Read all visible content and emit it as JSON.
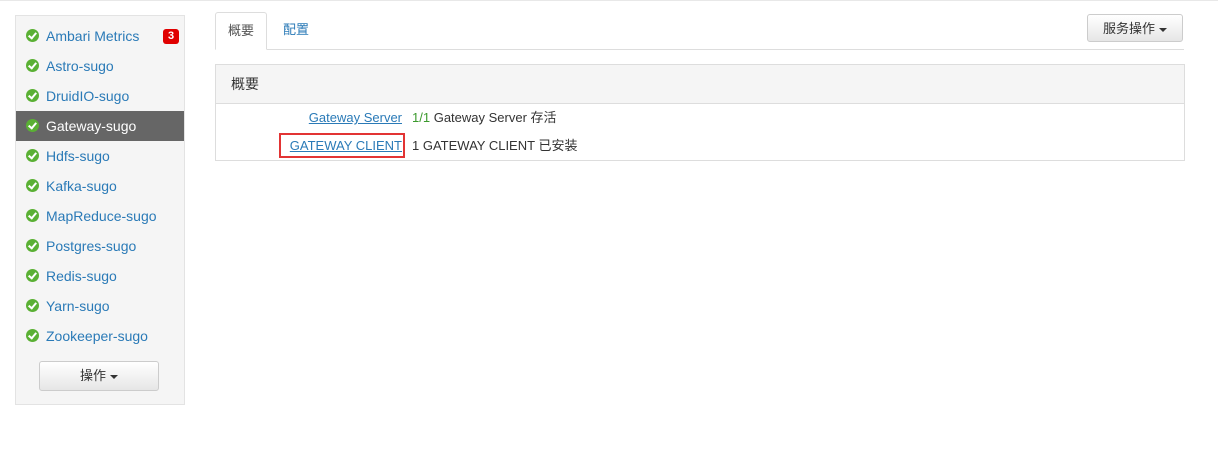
{
  "sidebar": {
    "services": [
      {
        "name": "Ambari Metrics",
        "badge": "3",
        "active": false
      },
      {
        "name": "Astro-sugo",
        "active": false
      },
      {
        "name": "DruidIO-sugo",
        "active": false
      },
      {
        "name": "Gateway-sugo",
        "active": true
      },
      {
        "name": "Hdfs-sugo",
        "active": false
      },
      {
        "name": "Kafka-sugo",
        "active": false
      },
      {
        "name": "MapReduce-sugo",
        "active": false
      },
      {
        "name": "Postgres-sugo",
        "active": false
      },
      {
        "name": "Redis-sugo",
        "active": false
      },
      {
        "name": "Yarn-sugo",
        "active": false
      },
      {
        "name": "Zookeeper-sugo",
        "active": false
      }
    ],
    "actions_label": "操作"
  },
  "tabs": [
    {
      "label": "概要",
      "active": true
    },
    {
      "label": "配置",
      "active": false
    }
  ],
  "service_actions_label": "服务操作",
  "summary": {
    "title": "概要",
    "rows": [
      {
        "link": "Gateway Server",
        "count": "1/1",
        "text": "Gateway Server 存活"
      },
      {
        "link": "GATEWAY CLIENT",
        "count": "1",
        "text": "GATEWAY CLIENT 已安装"
      }
    ]
  },
  "colors": {
    "link": "#2a7ab7",
    "check": "#5ab034",
    "badge": "#e00000",
    "highlight": "#e23434",
    "active_item": "#666666"
  }
}
